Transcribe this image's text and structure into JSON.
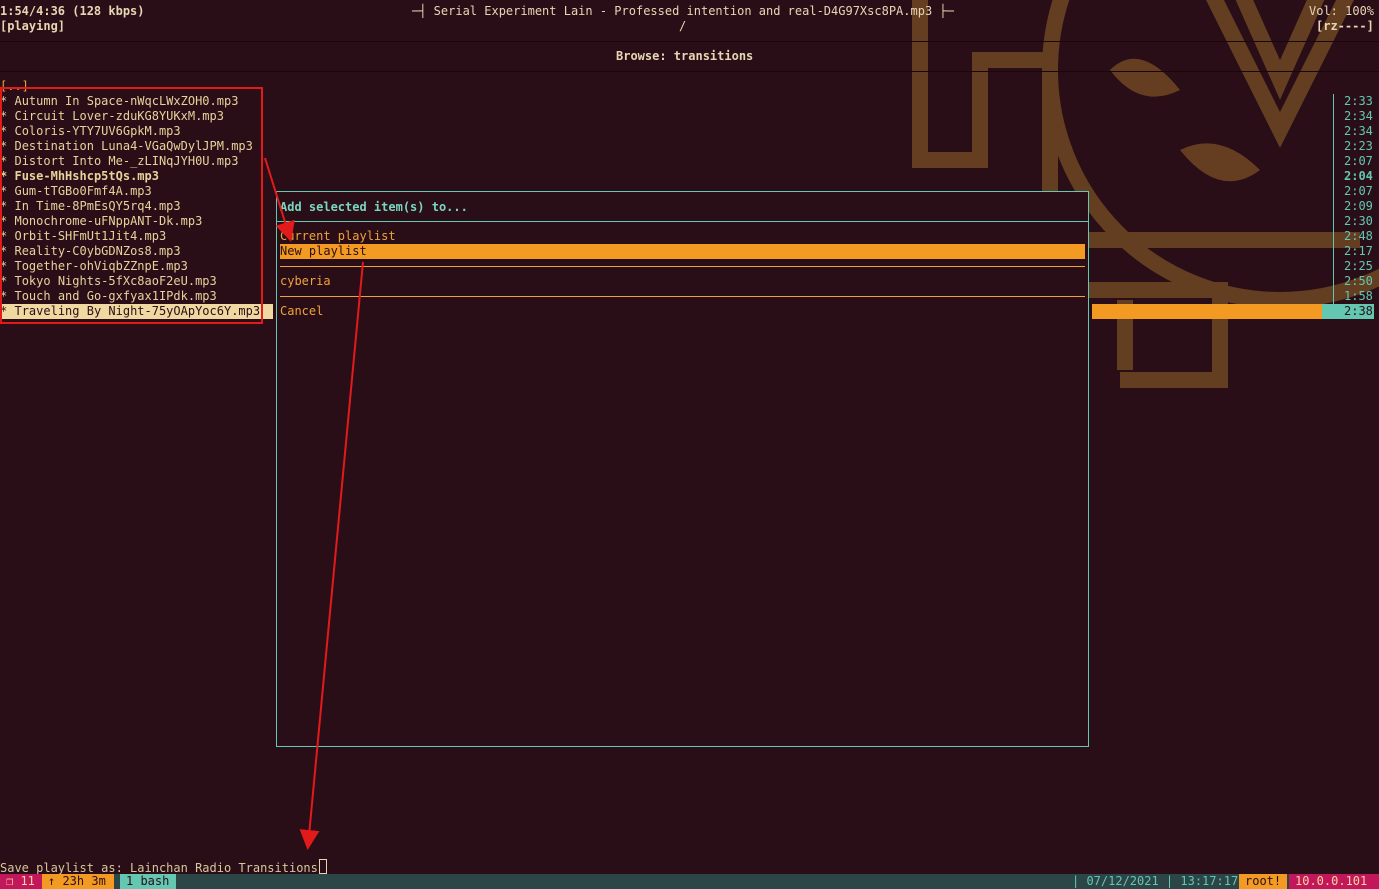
{
  "header": {
    "time": "1:54/4:36 (128 kbps)",
    "state": "[playing]",
    "now_playing": "─┤ Serial Experiment Lain - Professed intention and real-D4G97Xsc8PA.mp3 ├─",
    "path": "/",
    "volume": "Vol: 100%",
    "flags": "[rz----]",
    "browse_title": "Browse: transitions"
  },
  "browser": {
    "parent": "[..]",
    "items": [
      {
        "name": "Autumn In Space-nWqcLWxZOH0.mp3",
        "duration": "2:33"
      },
      {
        "name": "Circuit Lover-zduKG8YUKxM.mp3",
        "duration": "2:34"
      },
      {
        "name": "Coloris-YTY7UV6GpkM.mp3",
        "duration": "2:34"
      },
      {
        "name": "Destination Luna4-VGaQwDylJPM.mp3",
        "duration": "2:23"
      },
      {
        "name": "Distort Into Me-_zLINqJYH0U.mp3",
        "duration": "2:07"
      },
      {
        "name": "Fuse-MhHshcp5tQs.mp3",
        "duration": "2:04"
      },
      {
        "name": "Gum-tTGBo0Fmf4A.mp3",
        "duration": "2:07"
      },
      {
        "name": "In Time-8PmEsQY5rq4.mp3",
        "duration": "2:09"
      },
      {
        "name": "Monochrome-uFNppANT-Dk.mp3",
        "duration": "2:30"
      },
      {
        "name": "Orbit-SHFmUt1Jit4.mp3",
        "duration": "2:48"
      },
      {
        "name": "Reality-C0ybGDNZos8.mp3",
        "duration": "2:17"
      },
      {
        "name": "Together-ohViqbZZnpE.mp3",
        "duration": "2:25"
      },
      {
        "name": "Tokyo Nights-5fXc8aoF2eU.mp3",
        "duration": "2:50"
      },
      {
        "name": "Touch and Go-gxfyax1IPdk.mp3",
        "duration": "1:58"
      },
      {
        "name": "Traveling By Night-75yOApYoc6Y.mp3",
        "duration": "2:38"
      }
    ],
    "bullet": "*"
  },
  "dialog": {
    "title": "Add selected item(s) to...",
    "options": [
      "Current playlist",
      "New playlist",
      "cyberia",
      "Cancel"
    ]
  },
  "prompt": {
    "text": "Save playlist as: Lainchan Radio Transitions"
  },
  "statusbar": {
    "session": "❐ 11",
    "uptime": "↑ 23h 3m",
    "window": "1 bash",
    "date": "| 07/12/2021 | 13:17:17",
    "user": "root!",
    "ip": "10.0.0.101"
  },
  "colors": {
    "background": "#2a0e17",
    "accent_orange": "#f39a22",
    "accent_teal": "#63c7b2",
    "annotation_red": "#e21a1a"
  }
}
